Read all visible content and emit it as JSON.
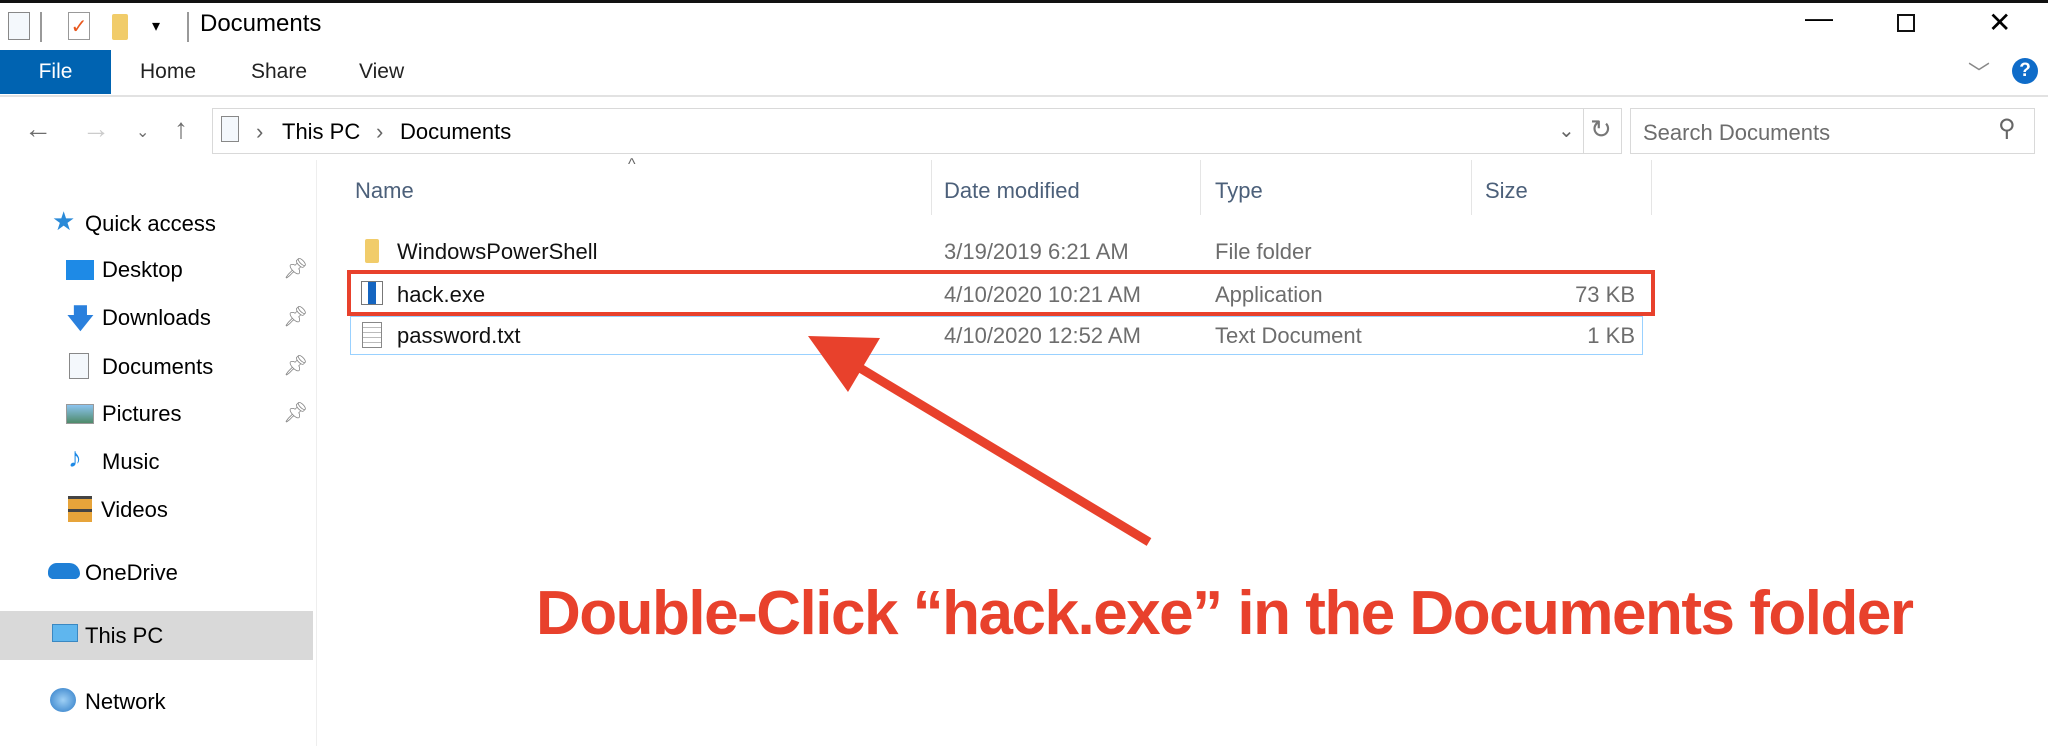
{
  "window": {
    "title": "Documents"
  },
  "ribbon": {
    "tabs": [
      "File",
      "Home",
      "Share",
      "View"
    ]
  },
  "address": {
    "crumbs": [
      "This PC",
      "Documents"
    ],
    "search_placeholder": "Search Documents"
  },
  "sidebar": {
    "quick_access": "Quick access",
    "pinned": [
      {
        "label": "Desktop"
      },
      {
        "label": "Downloads"
      },
      {
        "label": "Documents"
      },
      {
        "label": "Pictures"
      }
    ],
    "items": [
      {
        "label": "Music"
      },
      {
        "label": "Videos"
      }
    ],
    "onedrive": "OneDrive",
    "this_pc": "This PC",
    "network": "Network"
  },
  "columns": {
    "name": "Name",
    "date": "Date modified",
    "type": "Type",
    "size": "Size"
  },
  "files": [
    {
      "name": "WindowsPowerShell",
      "date": "3/19/2019 6:21 AM",
      "type": "File folder",
      "size": ""
    },
    {
      "name": "hack.exe",
      "date": "4/10/2020 10:21 AM",
      "type": "Application",
      "size": "73 KB"
    },
    {
      "name": "password.txt",
      "date": "4/10/2020 12:52 AM",
      "type": "Text Document",
      "size": "1 KB"
    }
  ],
  "annotation": {
    "text": "Double-Click “hack.exe” in the Documents folder",
    "color": "#e8412c"
  }
}
